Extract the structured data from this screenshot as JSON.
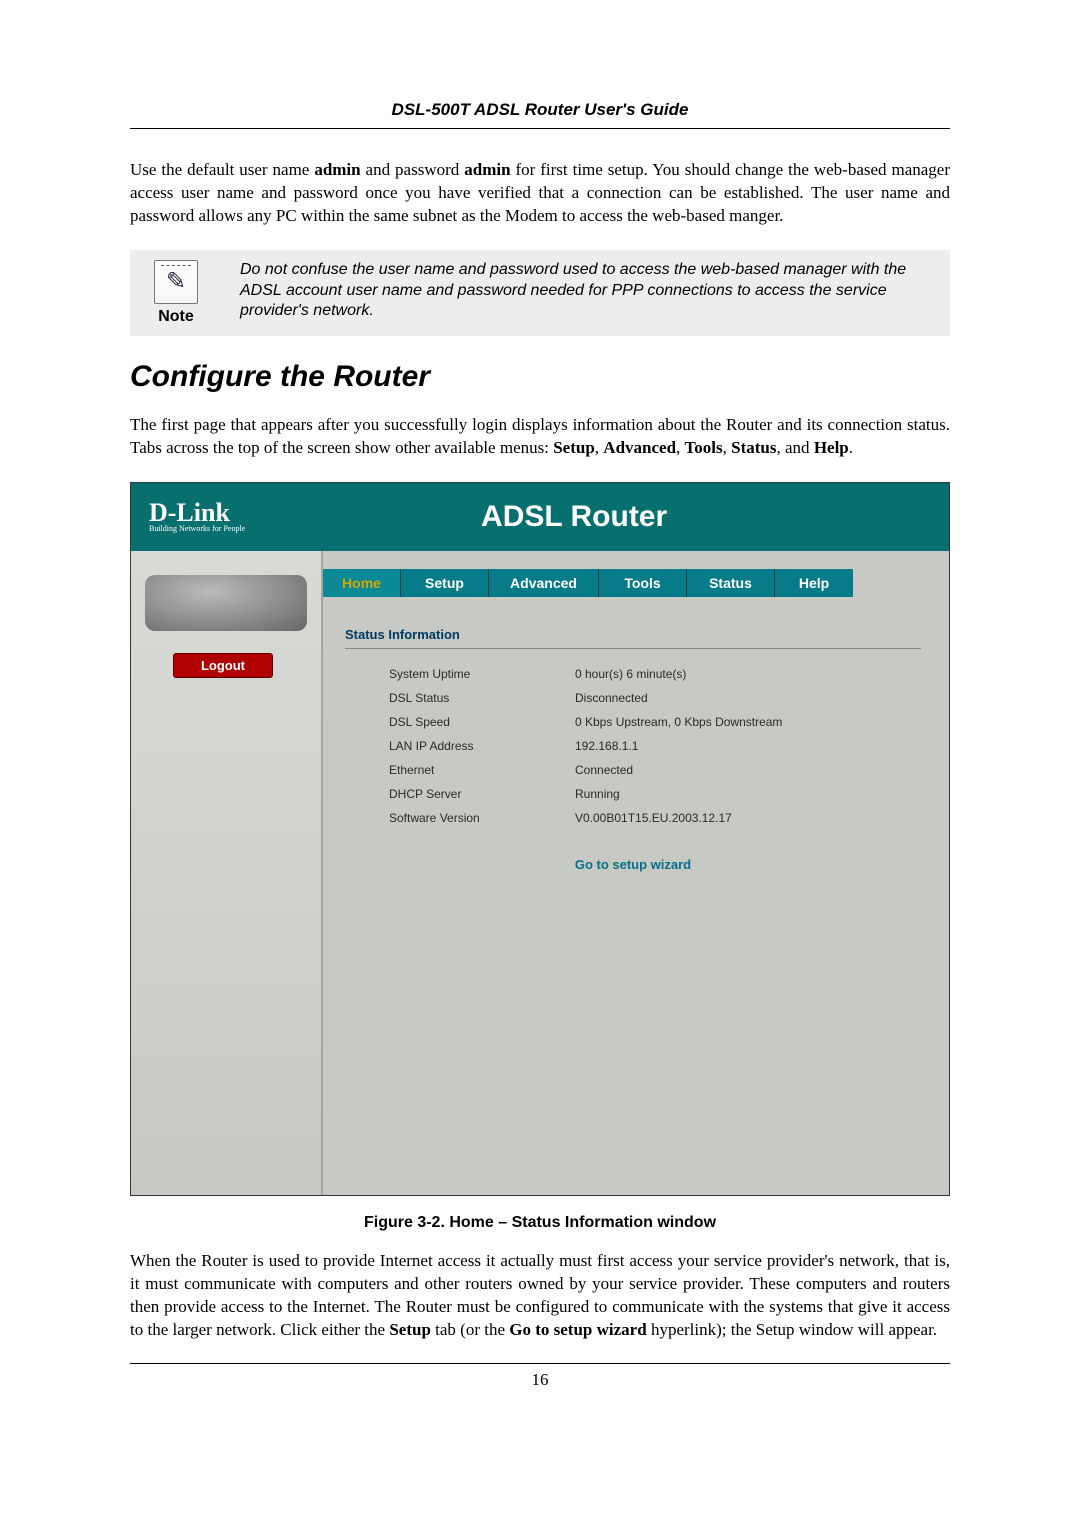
{
  "header": {
    "title": "DSL-500T ADSL Router User's Guide"
  },
  "p1": {
    "pre": "Use the default user name ",
    "b1": "admin",
    "mid": " and password ",
    "b2": "admin",
    "post": " for first time setup. You should change the web-based manager access user name and password once you have verified that a connection can be established. The user name and password allows any PC within the same subnet as the Modem to access the web-based manger."
  },
  "note": {
    "label": "Note",
    "text": "Do not confuse the user name and password used to access the web-based manager with the ADSL account user name and password needed for PPP connections to access the service provider's network."
  },
  "h2": "Configure the Router",
  "p2": {
    "pre": "The first page that appears after you successfully login displays information about the Router and its connection status. Tabs across the top of the screen show other available menus: ",
    "b1": "Setup",
    "c1": ", ",
    "b2": "Advanced",
    "c2": ", ",
    "b3": "Tools",
    "c3": ", ",
    "b4": "Status",
    "c4": ", and ",
    "b5": "Help",
    "c5": "."
  },
  "router": {
    "logo_big": "D-Link",
    "logo_small": "Building Networks for People",
    "title": "ADSL Router",
    "logout": "Logout",
    "tabs": [
      "Home",
      "Setup",
      "Advanced",
      "Tools",
      "Status",
      "Help"
    ],
    "panel_title": "Status Information",
    "rows": [
      {
        "k": "System Uptime",
        "v": "0 hour(s) 6 minute(s)"
      },
      {
        "k": "DSL Status",
        "v": "Disconnected"
      },
      {
        "k": "DSL Speed",
        "v": "0 Kbps Upstream, 0 Kbps Downstream"
      },
      {
        "k": "LAN IP Address",
        "v": "192.168.1.1"
      },
      {
        "k": "Ethernet",
        "v": "Connected"
      },
      {
        "k": "DHCP Server",
        "v": "Running"
      },
      {
        "k": "Software Version",
        "v": "V0.00B01T15.EU.2003.12.17"
      }
    ],
    "wizard": "Go to setup wizard"
  },
  "fig_cap": "Figure 3-2. Home – Status Information window",
  "p3": {
    "pre": "When the Router is used to provide Internet access it actually must first access your service provider's network, that is, it must communicate with computers and other routers owned by your service provider. These computers and routers then provide access to the Internet. The Router must be configured to communicate with the systems that give it access to the larger network. Click either the ",
    "b1": "Setup",
    "mid": " tab (or the ",
    "b2": "Go to setup wizard",
    "post": " hyperlink); the Setup window will appear."
  },
  "page_no": "16"
}
